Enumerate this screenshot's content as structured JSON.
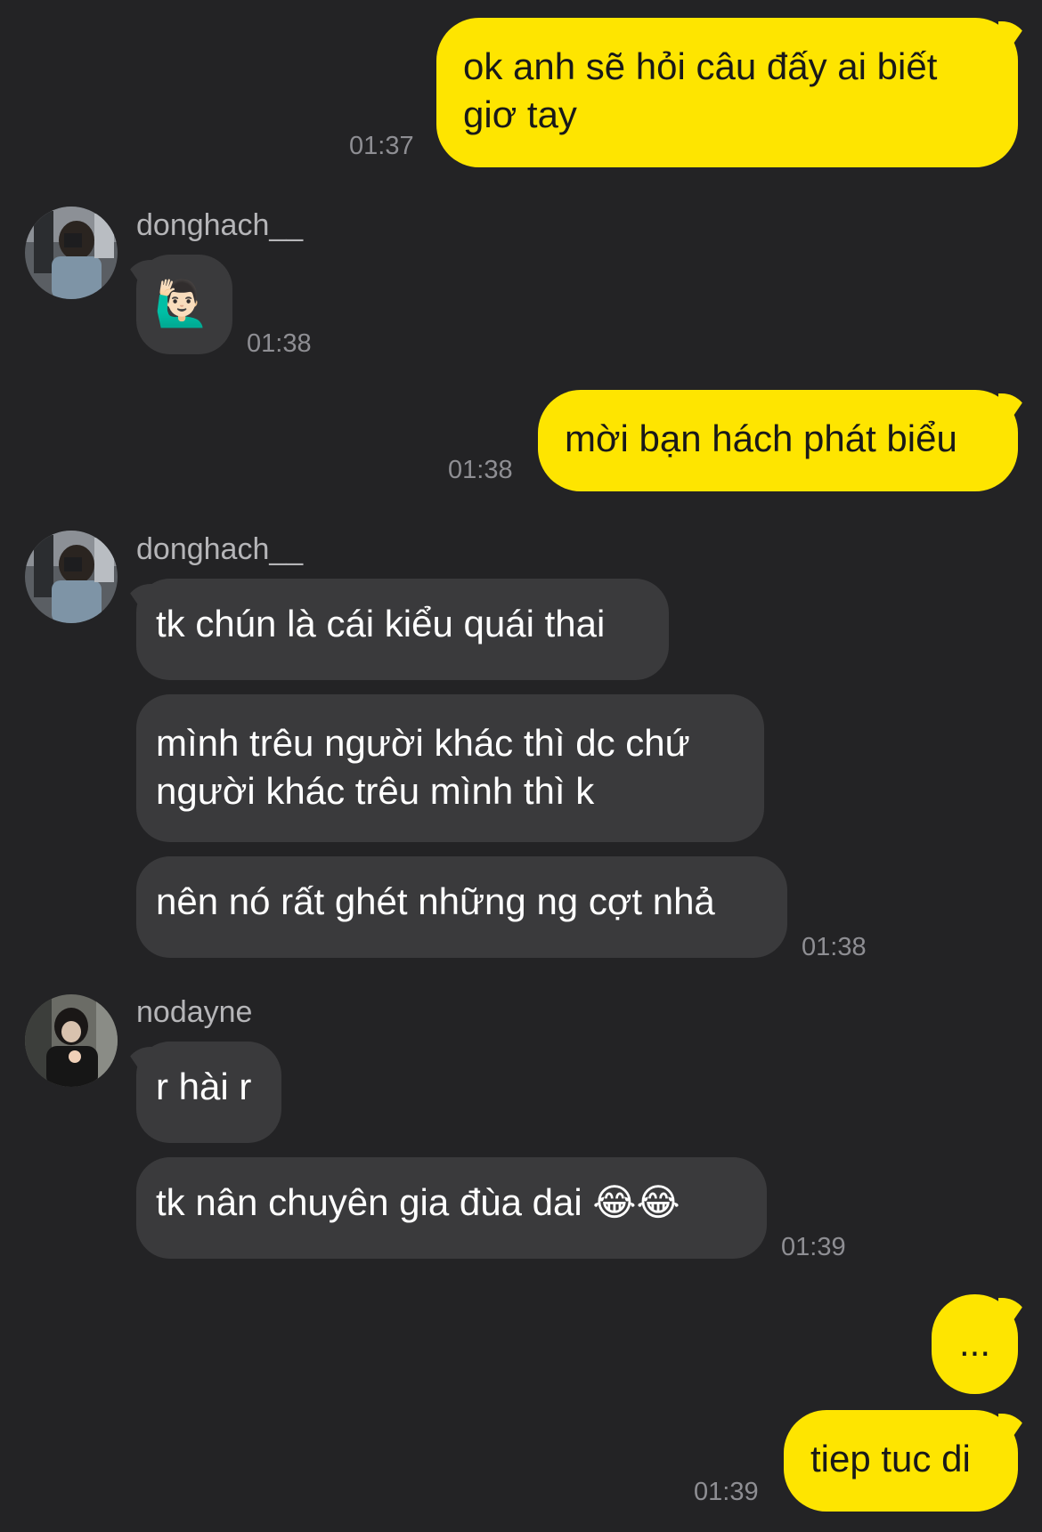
{
  "messages": {
    "m1": {
      "text_line1": "ok anh sẽ hỏi câu đấy ai biết",
      "text_line2": "giơ tay",
      "time": "01:37"
    },
    "m2": {
      "sender": "donghach__",
      "emoji": "🙋🏻‍♂️",
      "time": "01:38"
    },
    "m3": {
      "text": "mời bạn hách phát biểu",
      "time": "01:38"
    },
    "m4": {
      "sender": "donghach__",
      "b1": "tk chún là cái kiểu quái thai",
      "b2_line1": "mình trêu người khác thì dc chứ",
      "b2_line2": "người khác trêu mình thì k",
      "b3": "nên nó rất ghét những ng cợt nhả",
      "time": "01:38"
    },
    "m5": {
      "sender": "nodayne",
      "b1": "r hài r",
      "b2": "tk nân chuyên gia đùa dai 😂😂",
      "time": "01:39"
    },
    "m6": {
      "text": "...",
      "text2": "tiep tuc di",
      "time": "01:39"
    }
  },
  "colors": {
    "background": "#232325",
    "outgoing_bubble": "#FEE500",
    "incoming_bubble": "#3a3a3c",
    "timestamp": "#8e8e93"
  }
}
